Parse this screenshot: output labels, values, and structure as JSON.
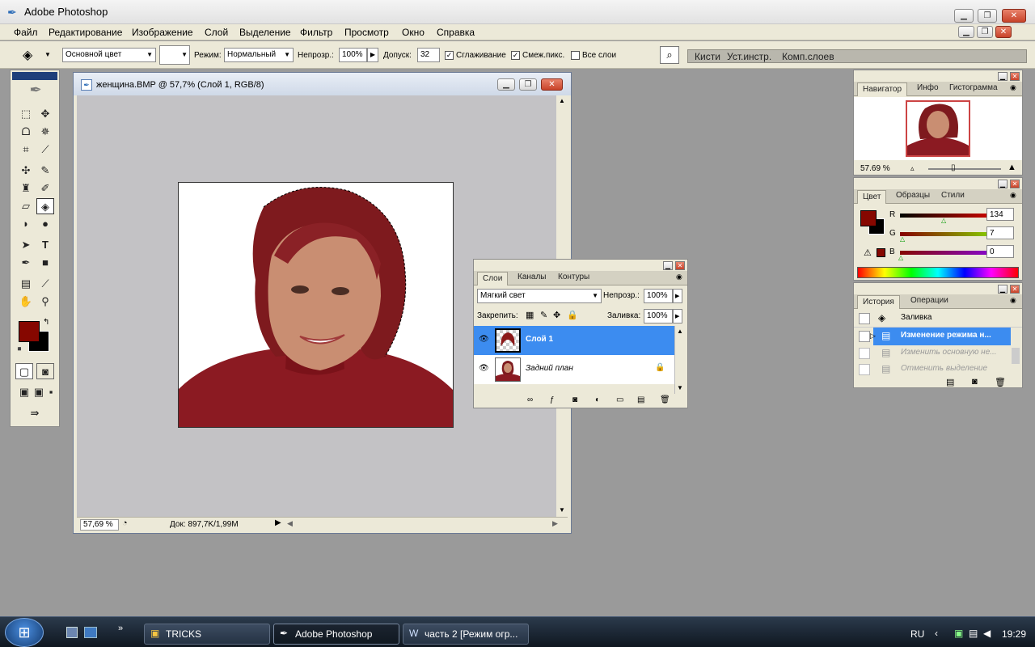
{
  "app": {
    "title": "Adobe Photoshop",
    "icon": "photoshop-feather-icon"
  },
  "menu": [
    "Файл",
    "Редактирование",
    "Изображение",
    "Слой",
    "Выделение",
    "Фильтр",
    "Просмотр",
    "Окно",
    "Справка"
  ],
  "options": {
    "fill_source": "Основной цвет",
    "mode_label": "Режим:",
    "mode_value": "Нормальный",
    "opacity_label": "Непрозр.:",
    "opacity_value": "100%",
    "tolerance_label": "Допуск:",
    "tolerance_value": "32",
    "antialias": "Сглаживание",
    "contiguous": "Смеж.пикс.",
    "all_layers": "Все слои"
  },
  "palette_well": [
    "Кисти",
    "Уст.инстр.",
    "Комп.слоев"
  ],
  "document": {
    "title": "женщина.BMP @ 57,7% (Слой 1, RGB/8)",
    "zoom": "57,69 %",
    "doc_size": "Док: 897,7K/1,99M"
  },
  "navigator": {
    "tabs": [
      "Навигатор",
      "Инфо",
      "Гистограмма"
    ],
    "zoom": "57.69 %"
  },
  "color": {
    "tabs": [
      "Цвет",
      "Образцы",
      "Стили"
    ],
    "r_label": "R",
    "r": "134",
    "g_label": "G",
    "g": "7",
    "b_label": "B",
    "b": "0",
    "foreground": "#860700"
  },
  "history": {
    "tabs": [
      "История",
      "Операции"
    ],
    "items": [
      "Заливка",
      "Изменение режима н...",
      "Изменить основную не...",
      "Отменить выделение"
    ]
  },
  "layers": {
    "tabs": [
      "Слои",
      "Каналы",
      "Контуры"
    ],
    "blend": "Мягкий свет",
    "opacity_label": "Непрозр.:",
    "opacity": "100%",
    "lock_label": "Закрепить:",
    "fill_label": "Заливка:",
    "fill": "100%",
    "items": [
      "Слой 1",
      "Задний план"
    ]
  },
  "taskbar": {
    "tasks": [
      "TRICKS",
      "Adobe Photoshop",
      "часть 2 [Режим огр..."
    ],
    "lang": "RU",
    "time": "19:29"
  }
}
